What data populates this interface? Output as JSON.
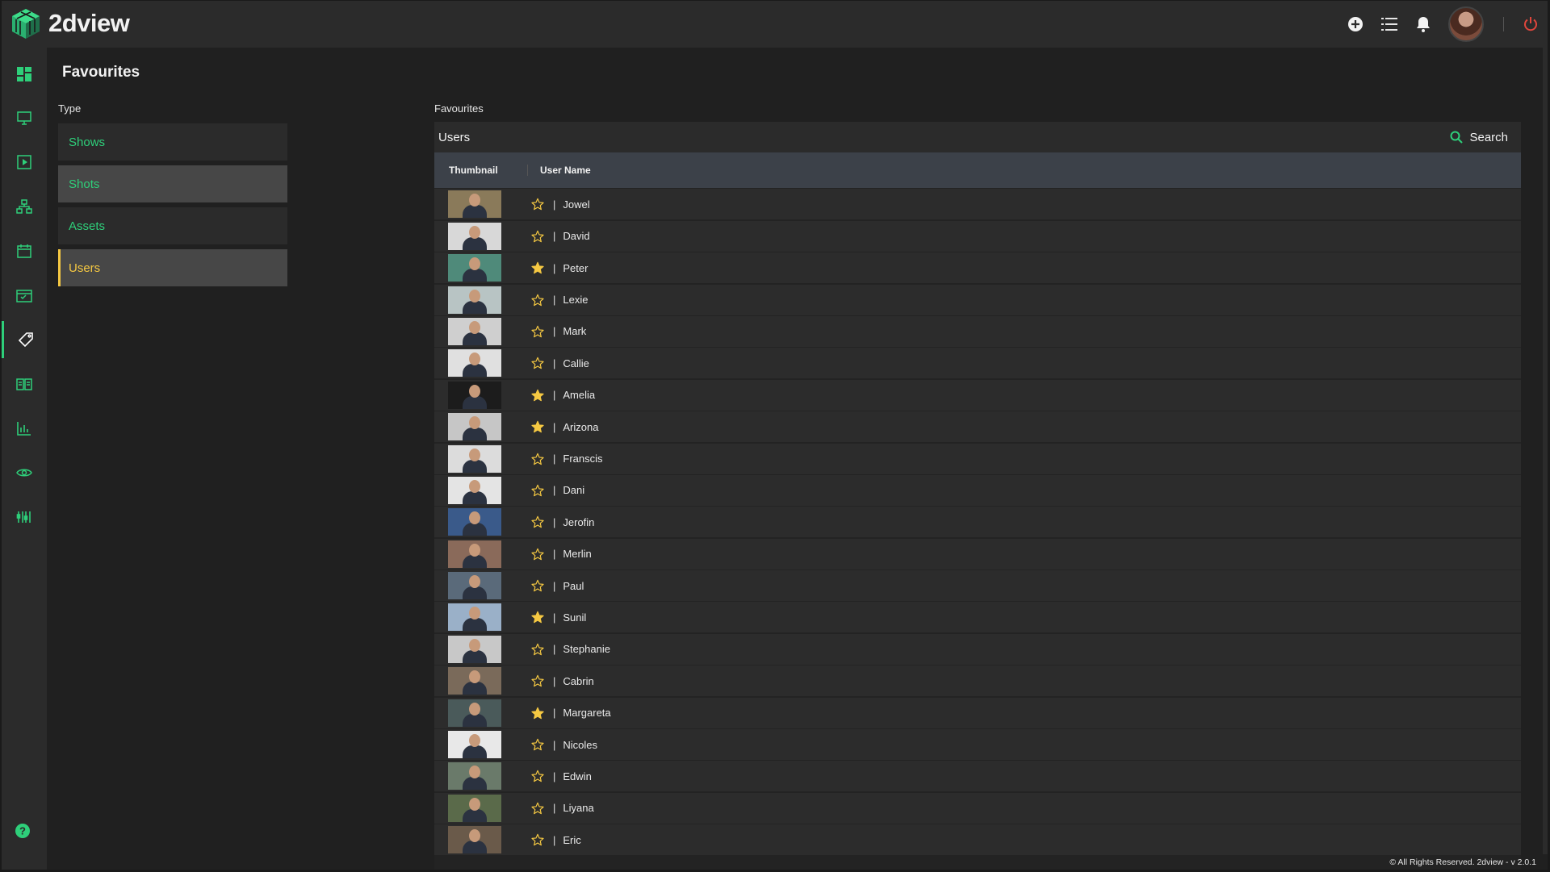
{
  "app": {
    "brand": "2dview"
  },
  "colors": {
    "accent": "#2ecf7a",
    "active": "#f5c842",
    "logout": "#e0463c"
  },
  "topbar": {
    "icons": [
      "add-circle-icon",
      "list-icon",
      "bell-icon",
      "avatar",
      "power-icon"
    ]
  },
  "rail": {
    "items": [
      "dashboard-icon",
      "monitor-icon",
      "play-icon",
      "hierarchy-icon",
      "calendar-icon",
      "calendar-check-icon",
      "tag-icon",
      "book-icon",
      "bar-chart-icon",
      "eye-icon",
      "sliders-icon"
    ],
    "active_index": 6,
    "help_icon": "help-icon"
  },
  "page": {
    "title": "Favourites",
    "type_label": "Type",
    "types": [
      {
        "label": "Shows",
        "state": "normal"
      },
      {
        "label": "Shots",
        "state": "selected"
      },
      {
        "label": "Assets",
        "state": "normal"
      },
      {
        "label": "Users",
        "state": "active"
      }
    ]
  },
  "favourites": {
    "label": "Favourites",
    "panel_title": "Users",
    "search_label": "Search",
    "columns": [
      "Thumbnail",
      "User Name"
    ],
    "rows": [
      {
        "name": "Jowel",
        "favourite": false,
        "thumb": "#8a7a5a"
      },
      {
        "name": "David",
        "favourite": false,
        "thumb": "#d8d8d8"
      },
      {
        "name": "Peter",
        "favourite": true,
        "thumb": "#4f8a7a"
      },
      {
        "name": "Lexie",
        "favourite": false,
        "thumb": "#b8c4c4"
      },
      {
        "name": "Mark",
        "favourite": false,
        "thumb": "#cfcfcf"
      },
      {
        "name": "Callie",
        "favourite": false,
        "thumb": "#e0e0e0"
      },
      {
        "name": "Amelia",
        "favourite": true,
        "thumb": "#1c1c1c"
      },
      {
        "name": "Arizona",
        "favourite": true,
        "thumb": "#c6c6c6"
      },
      {
        "name": "Franscis",
        "favourite": false,
        "thumb": "#dcdcdc"
      },
      {
        "name": "Dani",
        "favourite": false,
        "thumb": "#e4e4e4"
      },
      {
        "name": "Jerofin",
        "favourite": false,
        "thumb": "#3a5a8a"
      },
      {
        "name": "Merlin",
        "favourite": false,
        "thumb": "#8a6a5a"
      },
      {
        "name": "Paul",
        "favourite": false,
        "thumb": "#5a6a7a"
      },
      {
        "name": "Sunil",
        "favourite": true,
        "thumb": "#9ab0c8"
      },
      {
        "name": "Stephanie",
        "favourite": false,
        "thumb": "#c8c8c8"
      },
      {
        "name": "Cabrin",
        "favourite": false,
        "thumb": "#7a6a5a"
      },
      {
        "name": "Margareta",
        "favourite": true,
        "thumb": "#4a5a5a"
      },
      {
        "name": "Nicoles",
        "favourite": false,
        "thumb": "#e8e8e8"
      },
      {
        "name": "Edwin",
        "favourite": false,
        "thumb": "#6a7a6a"
      },
      {
        "name": "Liyana",
        "favourite": false,
        "thumb": "#5a6a4a"
      },
      {
        "name": "Eric",
        "favourite": false,
        "thumb": "#6a5a4a"
      }
    ]
  },
  "footer": {
    "text": "© All Rights Reserved. 2dview - v 2.0.1"
  }
}
